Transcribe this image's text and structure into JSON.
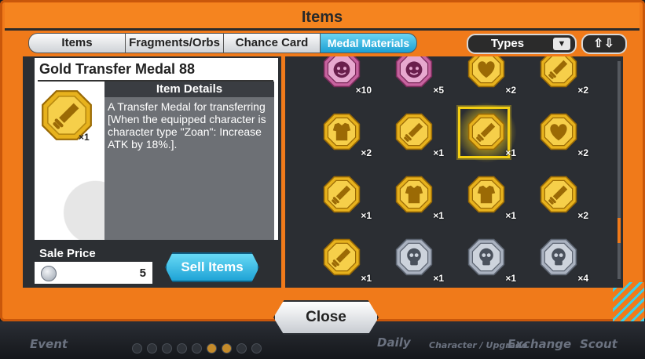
{
  "window": {
    "title": "Items"
  },
  "tabs": [
    {
      "label": "Items"
    },
    {
      "label": "Fragments/Orbs"
    },
    {
      "label": "Chance Card"
    },
    {
      "label": "Medal Materials",
      "active": true
    }
  ],
  "filter": {
    "label": "Types",
    "arrow_icon": "chevron-down-icon",
    "sort_label": "⇧⇩"
  },
  "detail": {
    "name": "Gold Transfer Medal 88",
    "header": "Item Details",
    "count": "×1",
    "description": "A Transfer Medal for transferring [When the equipped character is character type \"Zoan\": Increase ATK by 18%.]."
  },
  "sale": {
    "label": "Sale Price",
    "value": "5",
    "coin_icon": "silver-coin-icon"
  },
  "buttons": {
    "sell": "Sell Items",
    "close": "Close"
  },
  "colors": {
    "accent": "#f07a1a",
    "gold": "#e7b21d",
    "silver": "#aab2c0",
    "pink": "#c7639f",
    "select": "#f4cf13"
  },
  "grid": [
    {
      "icon": "pink-character-medal-icon",
      "kind": "pink",
      "symbol": "face",
      "count": "×10"
    },
    {
      "icon": "pink-character-medal-icon",
      "kind": "pink",
      "symbol": "face",
      "count": "×5"
    },
    {
      "icon": "gold-heart-medal-icon",
      "kind": "gold",
      "symbol": "heart",
      "count": "×2"
    },
    {
      "icon": "gold-sword-medal-icon",
      "kind": "gold",
      "symbol": "sword",
      "count": "×2"
    },
    {
      "icon": "gold-armor-medal-icon",
      "kind": "gold",
      "symbol": "armor",
      "count": "×2"
    },
    {
      "icon": "gold-sword-medal-icon",
      "kind": "gold",
      "symbol": "sword",
      "count": "×1"
    },
    {
      "icon": "gold-sword-medal-icon",
      "kind": "gold",
      "symbol": "sword",
      "count": "×1",
      "selected": true
    },
    {
      "icon": "gold-heart-medal-icon",
      "kind": "gold",
      "symbol": "heart",
      "count": "×2"
    },
    {
      "icon": "gold-sword-medal-icon",
      "kind": "gold",
      "symbol": "sword",
      "count": "×1"
    },
    {
      "icon": "gold-armor-medal-icon",
      "kind": "gold",
      "symbol": "armor",
      "count": "×1"
    },
    {
      "icon": "gold-armor-medal-icon",
      "kind": "gold",
      "symbol": "armor",
      "count": "×1"
    },
    {
      "icon": "gold-sword-medal-icon",
      "kind": "gold",
      "symbol": "sword",
      "count": "×2"
    },
    {
      "icon": "gold-sword-medal-icon",
      "kind": "gold",
      "symbol": "sword",
      "count": "×1"
    },
    {
      "icon": "silver-skull-medal-icon",
      "kind": "silver",
      "symbol": "skull",
      "count": "×1"
    },
    {
      "icon": "silver-skull-medal-icon",
      "kind": "silver",
      "symbol": "skull",
      "count": "×1"
    },
    {
      "icon": "silver-skull-medal-icon",
      "kind": "silver",
      "symbol": "skull",
      "count": "×4"
    }
  ],
  "background_nav": [
    "Event",
    "Daily",
    "Character / Upgrade",
    "Exchange",
    "Scout"
  ]
}
